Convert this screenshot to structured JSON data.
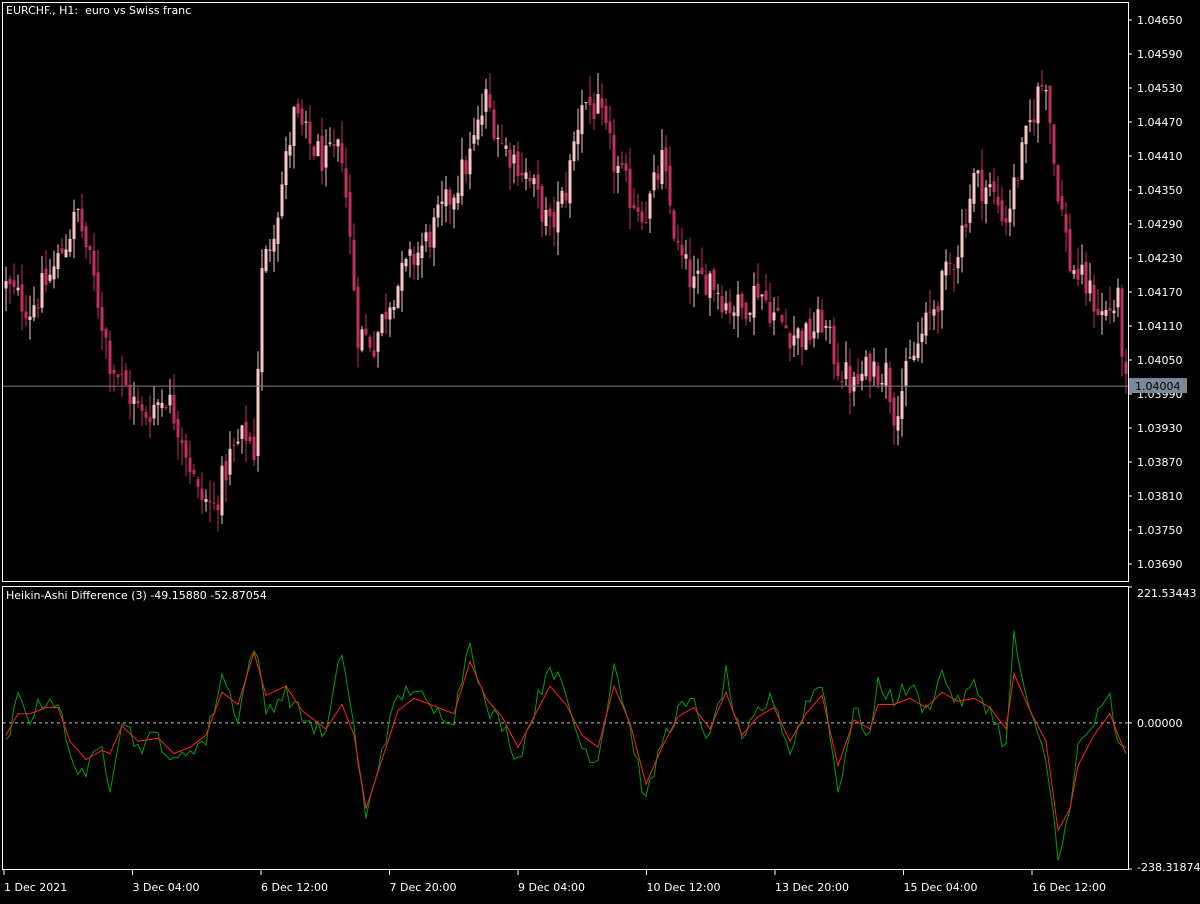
{
  "main": {
    "title": "EURCHF., H1:  euro vs Swiss franc",
    "price_ticks": [
      "1.04650",
      "1.04590",
      "1.04530",
      "1.04470",
      "1.04410",
      "1.04350",
      "1.04290",
      "1.04230",
      "1.04170",
      "1.04110",
      "1.04050",
      "1.03990",
      "1.03930",
      "1.03870",
      "1.03810",
      "1.03750",
      "1.03690"
    ],
    "current_price": "1.04004",
    "current_price_value": 1.04004
  },
  "indicator": {
    "title": "Heikin-Ashi Difference (3) -49.15880 -52.87054",
    "top_label": "221.53443",
    "zero_label": "0.00000",
    "bottom_label": "-238.31874"
  },
  "time_axis": [
    "1 Dec 2021",
    "3 Dec 04:00",
    "6 Dec 12:00",
    "7 Dec 20:00",
    "9 Dec 04:00",
    "10 Dec 12:00",
    "13 Dec 20:00",
    "15 Dec 04:00",
    "16 Dec 12:00"
  ],
  "colors": {
    "bull": "#f7c6c6",
    "bear": "#c0305e",
    "neutral": "#aadd99",
    "fast_line": "#00a000",
    "signal_line": "#ff2020",
    "frame": "#ffffff",
    "price_line": "#808080",
    "price_tag_bg": "#7b8a9b"
  },
  "chart_data": [
    {
      "type": "candlestick",
      "title": "EURCHF., H1:  euro vs Swiss franc",
      "ylim": [
        1.0366,
        1.0468
      ],
      "close_anchors": [
        [
          0,
          1.0418
        ],
        [
          6,
          1.0414
        ],
        [
          12,
          1.0421
        ],
        [
          18,
          1.0431
        ],
        [
          22,
          1.0419
        ],
        [
          26,
          1.0405
        ],
        [
          30,
          1.04
        ],
        [
          34,
          1.0395
        ],
        [
          40,
          1.0399
        ],
        [
          44,
          1.0392
        ],
        [
          48,
          1.0381
        ],
        [
          52,
          1.0379
        ],
        [
          56,
          1.0388
        ],
        [
          60,
          1.0392
        ],
        [
          62,
          1.0389
        ],
        [
          64,
          1.042
        ],
        [
          68,
          1.0432
        ],
        [
          72,
          1.0448
        ],
        [
          76,
          1.0443
        ],
        [
          80,
          1.044
        ],
        [
          84,
          1.0442
        ],
        [
          88,
          1.041
        ],
        [
          92,
          1.0408
        ],
        [
          96,
          1.0416
        ],
        [
          100,
          1.0421
        ],
        [
          106,
          1.0427
        ],
        [
          112,
          1.0435
        ],
        [
          116,
          1.0441
        ],
        [
          120,
          1.0451
        ],
        [
          124,
          1.0443
        ],
        [
          128,
          1.044
        ],
        [
          132,
          1.0435
        ],
        [
          136,
          1.0428
        ],
        [
          140,
          1.0435
        ],
        [
          144,
          1.0451
        ],
        [
          148,
          1.0449
        ],
        [
          152,
          1.044
        ],
        [
          156,
          1.0434
        ],
        [
          160,
          1.0431
        ],
        [
          164,
          1.044
        ],
        [
          168,
          1.0424
        ],
        [
          172,
          1.0418
        ],
        [
          176,
          1.042
        ],
        [
          180,
          1.0415
        ],
        [
          184,
          1.0414
        ],
        [
          188,
          1.0418
        ],
        [
          192,
          1.0413
        ],
        [
          196,
          1.041
        ],
        [
          200,
          1.0409
        ],
        [
          204,
          1.0412
        ],
        [
          208,
          1.0404
        ],
        [
          212,
          1.04
        ],
        [
          216,
          1.0404
        ],
        [
          220,
          1.0403
        ],
        [
          222,
          1.0396
        ],
        [
          226,
          1.0404
        ],
        [
          230,
          1.0411
        ],
        [
          234,
          1.0418
        ],
        [
          238,
          1.0425
        ],
        [
          242,
          1.0437
        ],
        [
          246,
          1.0435
        ],
        [
          250,
          1.043
        ],
        [
          254,
          1.0441
        ],
        [
          258,
          1.0452
        ],
        [
          260,
          1.0455
        ],
        [
          262,
          1.044
        ],
        [
          266,
          1.0422
        ],
        [
          270,
          1.0418
        ],
        [
          274,
          1.0413
        ],
        [
          278,
          1.0415
        ],
        [
          280,
          1.04
        ]
      ]
    },
    {
      "type": "line",
      "title": "Heikin-Ashi Difference (3) -49.15880 -52.87054",
      "ylim": [
        -238.31874,
        221.53443
      ],
      "series": [
        {
          "color": "#00a000",
          "anchors": [
            [
              0,
              -40
            ],
            [
              3,
              40
            ],
            [
              6,
              10
            ],
            [
              10,
              40
            ],
            [
              13,
              35
            ],
            [
              16,
              -60
            ],
            [
              20,
              -80
            ],
            [
              24,
              -40
            ],
            [
              26,
              -100
            ],
            [
              29,
              10
            ],
            [
              33,
              -40
            ],
            [
              38,
              -20
            ],
            [
              42,
              -70
            ],
            [
              46,
              -40
            ],
            [
              50,
              -30
            ],
            [
              54,
              80
            ],
            [
              58,
              10
            ],
            [
              62,
              130
            ],
            [
              65,
              20
            ],
            [
              70,
              50
            ],
            [
              74,
              10
            ],
            [
              80,
              -20
            ],
            [
              84,
              120
            ],
            [
              87,
              -10
            ],
            [
              90,
              -160
            ],
            [
              94,
              -40
            ],
            [
              98,
              40
            ],
            [
              102,
              60
            ],
            [
              106,
              20
            ],
            [
              112,
              10
            ],
            [
              116,
              140
            ],
            [
              120,
              20
            ],
            [
              124,
              0
            ],
            [
              128,
              -60
            ],
            [
              132,
              20
            ],
            [
              136,
              100
            ],
            [
              140,
              40
            ],
            [
              144,
              -40
            ],
            [
              148,
              -60
            ],
            [
              152,
              100
            ],
            [
              156,
              -10
            ],
            [
              160,
              -130
            ],
            [
              164,
              -30
            ],
            [
              168,
              20
            ],
            [
              172,
              30
            ],
            [
              176,
              -30
            ],
            [
              180,
              80
            ],
            [
              184,
              -40
            ],
            [
              188,
              20
            ],
            [
              192,
              40
            ],
            [
              196,
              -50
            ],
            [
              200,
              30
            ],
            [
              204,
              70
            ],
            [
              208,
              -110
            ],
            [
              212,
              20
            ],
            [
              216,
              -20
            ],
            [
              218,
              60
            ],
            [
              222,
              40
            ],
            [
              226,
              60
            ],
            [
              230,
              20
            ],
            [
              234,
              80
            ],
            [
              238,
              30
            ],
            [
              242,
              60
            ],
            [
              246,
              20
            ],
            [
              250,
              -40
            ],
            [
              252,
              140
            ],
            [
              256,
              10
            ],
            [
              260,
              -60
            ],
            [
              263,
              -210
            ],
            [
              266,
              -150
            ],
            [
              268,
              -40
            ],
            [
              272,
              0
            ],
            [
              276,
              40
            ],
            [
              278,
              -40
            ],
            [
              280,
              -50
            ]
          ]
        },
        {
          "color": "#ff2020",
          "anchors": [
            [
              0,
              -20
            ],
            [
              3,
              15
            ],
            [
              6,
              15
            ],
            [
              10,
              25
            ],
            [
              13,
              25
            ],
            [
              16,
              -30
            ],
            [
              20,
              -60
            ],
            [
              24,
              -45
            ],
            [
              26,
              -50
            ],
            [
              29,
              -5
            ],
            [
              33,
              -30
            ],
            [
              38,
              -25
            ],
            [
              42,
              -50
            ],
            [
              46,
              -40
            ],
            [
              50,
              -20
            ],
            [
              54,
              50
            ],
            [
              58,
              30
            ],
            [
              62,
              115
            ],
            [
              65,
              45
            ],
            [
              70,
              60
            ],
            [
              74,
              20
            ],
            [
              80,
              -10
            ],
            [
              84,
              30
            ],
            [
              87,
              -20
            ],
            [
              90,
              -140
            ],
            [
              94,
              -60
            ],
            [
              98,
              20
            ],
            [
              102,
              40
            ],
            [
              106,
              30
            ],
            [
              112,
              15
            ],
            [
              116,
              100
            ],
            [
              120,
              40
            ],
            [
              124,
              10
            ],
            [
              128,
              -40
            ],
            [
              132,
              10
            ],
            [
              136,
              60
            ],
            [
              140,
              30
            ],
            [
              144,
              -20
            ],
            [
              148,
              -40
            ],
            [
              152,
              60
            ],
            [
              156,
              0
            ],
            [
              160,
              -100
            ],
            [
              164,
              -40
            ],
            [
              168,
              10
            ],
            [
              172,
              25
            ],
            [
              176,
              -10
            ],
            [
              180,
              50
            ],
            [
              184,
              -20
            ],
            [
              188,
              10
            ],
            [
              192,
              25
            ],
            [
              196,
              -30
            ],
            [
              200,
              15
            ],
            [
              204,
              45
            ],
            [
              208,
              -70
            ],
            [
              212,
              5
            ],
            [
              216,
              -10
            ],
            [
              218,
              30
            ],
            [
              222,
              30
            ],
            [
              226,
              40
            ],
            [
              230,
              25
            ],
            [
              234,
              50
            ],
            [
              238,
              35
            ],
            [
              242,
              40
            ],
            [
              246,
              25
            ],
            [
              250,
              -10
            ],
            [
              252,
              80
            ],
            [
              256,
              20
            ],
            [
              260,
              -30
            ],
            [
              263,
              -175
            ],
            [
              266,
              -140
            ],
            [
              268,
              -70
            ],
            [
              272,
              -20
            ],
            [
              276,
              15
            ],
            [
              278,
              -20
            ],
            [
              280,
              -50
            ]
          ]
        }
      ]
    }
  ]
}
